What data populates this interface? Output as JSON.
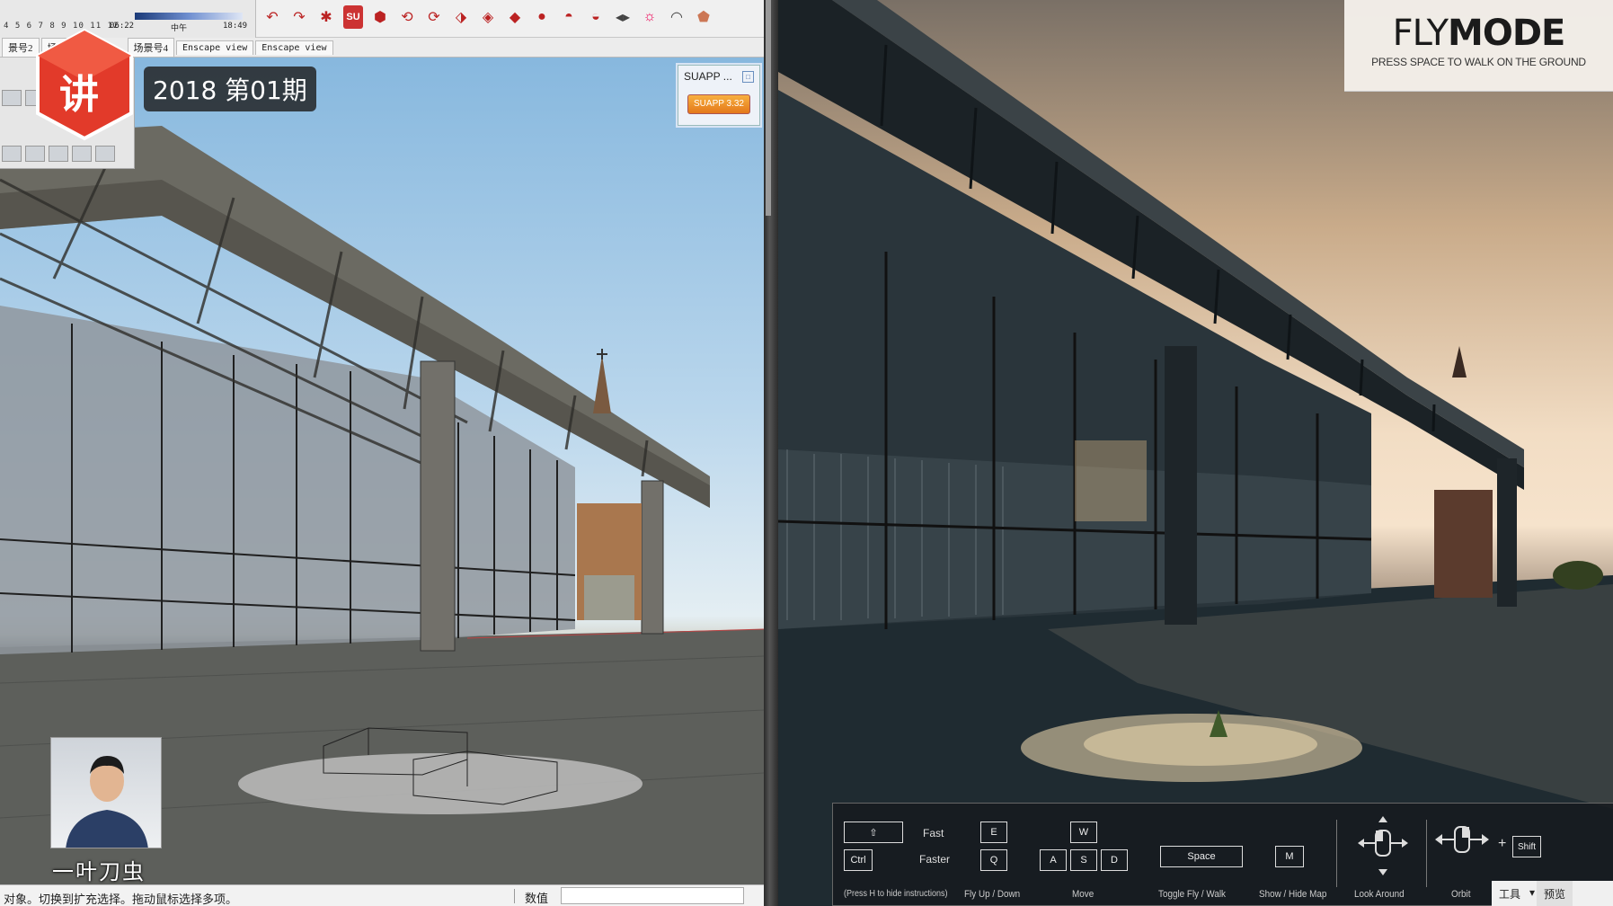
{
  "sketchup": {
    "timeline": {
      "frame_numbers": "4 5 6 7 8 9 10 11 12",
      "time_start": "06:22",
      "time_mid": "中午",
      "time_end": "18:49"
    },
    "scene_tabs": [
      "景号2",
      "场景",
      "场景号4",
      "Enscape view",
      "Enscape view"
    ],
    "suapp": {
      "title": "SUAPP ...",
      "button": "SUAPP 3.32"
    },
    "status": {
      "hint": "对象。切换到扩充选择。拖动鼠标选择多项。",
      "value_label": "数值",
      "value": ""
    }
  },
  "overlay": {
    "episode": "2018 第01期",
    "presenter_name": "一叶刀虫",
    "channel_logo": "讲"
  },
  "enscape": {
    "flymode": {
      "title_thin": "FLY",
      "title_bold": "MODE",
      "subtitle": "PRESS SPACE TO WALK ON THE GROUND"
    },
    "controls": {
      "fast_label": "Fast",
      "faster_label": "Faster",
      "ctrl_key": "Ctrl",
      "e_key": "E",
      "q_key": "Q",
      "w_key": "W",
      "a_key": "A",
      "s_key": "S",
      "d_key": "D",
      "space_key": "Space",
      "m_key": "M",
      "shift_key": "Shift",
      "plus": "+",
      "caption_hide": "(Press H to hide instructions)",
      "caption_fly": "Fly Up / Down",
      "caption_move": "Move",
      "caption_toggle": "Toggle Fly / Walk",
      "caption_map": "Show / Hide Map",
      "caption_look": "Look Around",
      "caption_orbit": "Orbit"
    }
  },
  "taskbar": {
    "tools": "工具",
    "preview": "预览"
  }
}
